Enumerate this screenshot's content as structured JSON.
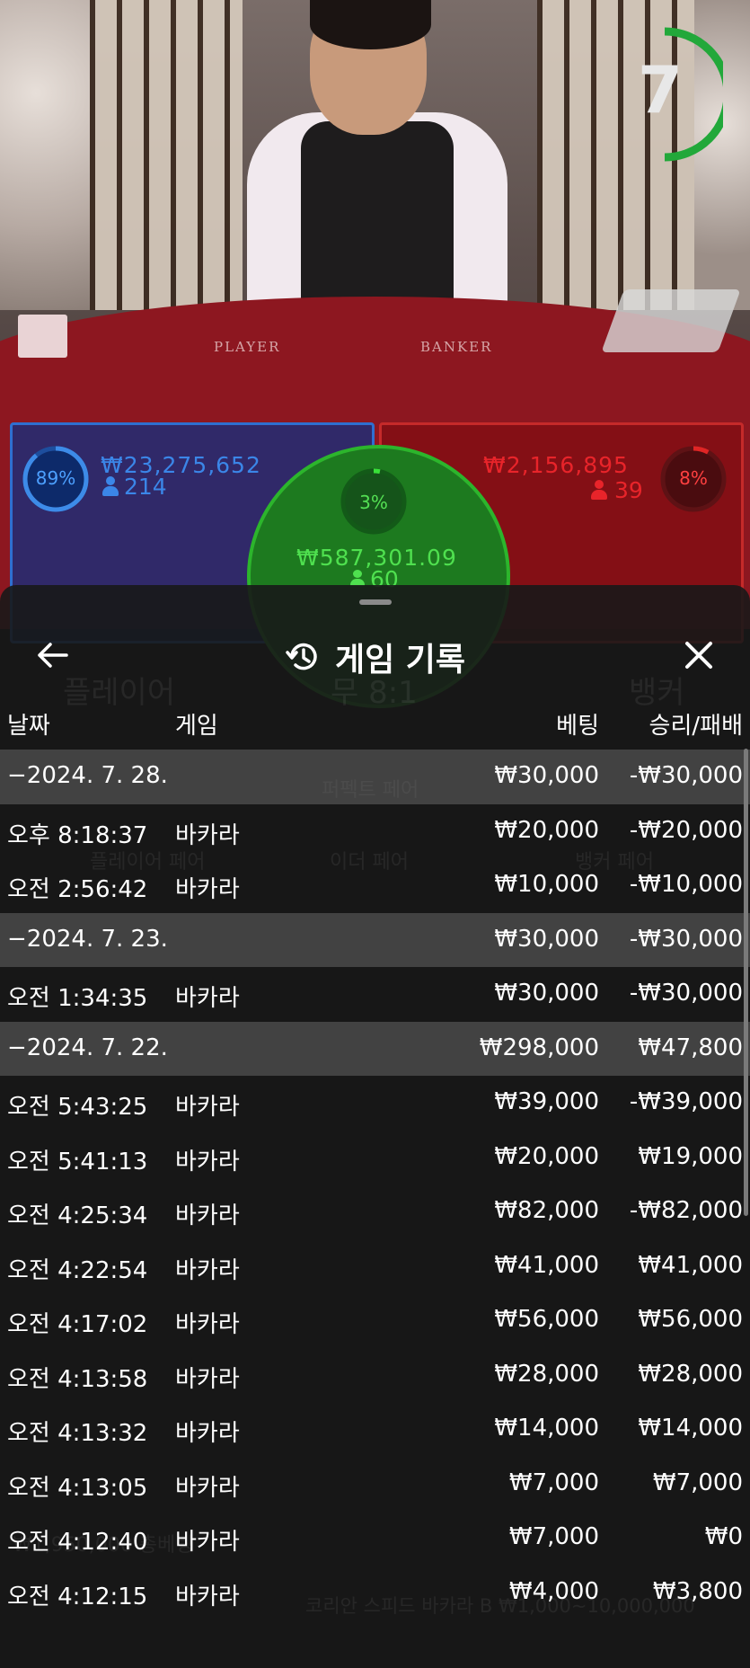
{
  "video": {
    "timer": "7",
    "felt_player": "PLAYER",
    "felt_banker": "BANKER",
    "player": {
      "percent": "89%",
      "amount": "₩23,275,652",
      "count": "214",
      "color": "#2f6fd0"
    },
    "banker": {
      "percent": "8%",
      "amount": "₩2,156,895",
      "count": "39",
      "color": "#d02a2a"
    },
    "tie": {
      "percent": "3%",
      "amount": "₩587,301.09",
      "count": "60",
      "color": "#2cb52c"
    }
  },
  "sheet": {
    "title": "게임 기록",
    "columns": {
      "date": "날짜",
      "game": "게임",
      "bet": "베팅",
      "result": "승리/패배"
    },
    "rows": [
      {
        "type": "date",
        "date": "−2024. 7. 28.",
        "game": "",
        "bet": "₩30,000",
        "result": "-₩30,000"
      },
      {
        "type": "item",
        "date": "오후 8:18:37",
        "game": "바카라",
        "bet": "₩20,000",
        "result": "-₩20,000"
      },
      {
        "type": "item",
        "date": "오전 2:56:42",
        "game": "바카라",
        "bet": "₩10,000",
        "result": "-₩10,000"
      },
      {
        "type": "date",
        "date": "−2024. 7. 23.",
        "game": "",
        "bet": "₩30,000",
        "result": "-₩30,000"
      },
      {
        "type": "item",
        "date": "오전 1:34:35",
        "game": "바카라",
        "bet": "₩30,000",
        "result": "-₩30,000"
      },
      {
        "type": "date",
        "date": "−2024. 7. 22.",
        "game": "",
        "bet": "₩298,000",
        "result": "₩47,800"
      },
      {
        "type": "item",
        "date": "오전 5:43:25",
        "game": "바카라",
        "bet": "₩39,000",
        "result": "-₩39,000"
      },
      {
        "type": "item",
        "date": "오전 5:41:13",
        "game": "바카라",
        "bet": "₩20,000",
        "result": "₩19,000"
      },
      {
        "type": "item",
        "date": "오전 4:25:34",
        "game": "바카라",
        "bet": "₩82,000",
        "result": "-₩82,000"
      },
      {
        "type": "item",
        "date": "오전 4:22:54",
        "game": "바카라",
        "bet": "₩41,000",
        "result": "₩41,000"
      },
      {
        "type": "item",
        "date": "오전 4:17:02",
        "game": "바카라",
        "bet": "₩56,000",
        "result": "₩56,000"
      },
      {
        "type": "item",
        "date": "오전 4:13:58",
        "game": "바카라",
        "bet": "₩28,000",
        "result": "₩28,000"
      },
      {
        "type": "item",
        "date": "오전 4:13:32",
        "game": "바카라",
        "bet": "₩14,000",
        "result": "₩14,000"
      },
      {
        "type": "item",
        "date": "오전 4:13:05",
        "game": "바카라",
        "bet": "₩7,000",
        "result": "₩7,000"
      },
      {
        "type": "item",
        "date": "오전 4:12:40",
        "game": "바카라",
        "bet": "₩7,000",
        "result": "₩0"
      },
      {
        "type": "item",
        "date": "오전 4:12:15",
        "game": "바카라",
        "bet": "₩4,000",
        "result": "₩3,800"
      }
    ]
  },
  "background": {
    "player_label": "플레이어",
    "tie_label": "무 8:1",
    "banker_label": "뱅커",
    "perfect_pair": "퍼펙트 페어",
    "either_pair": "이더 페어",
    "player_pair": "플레이어 페어",
    "banker_pair": "뱅커 페어",
    "table_name": "코리안 스피드 바카라 B ₩1,000~10,000,000",
    "balance": "₩1,950,000 총베팅"
  }
}
